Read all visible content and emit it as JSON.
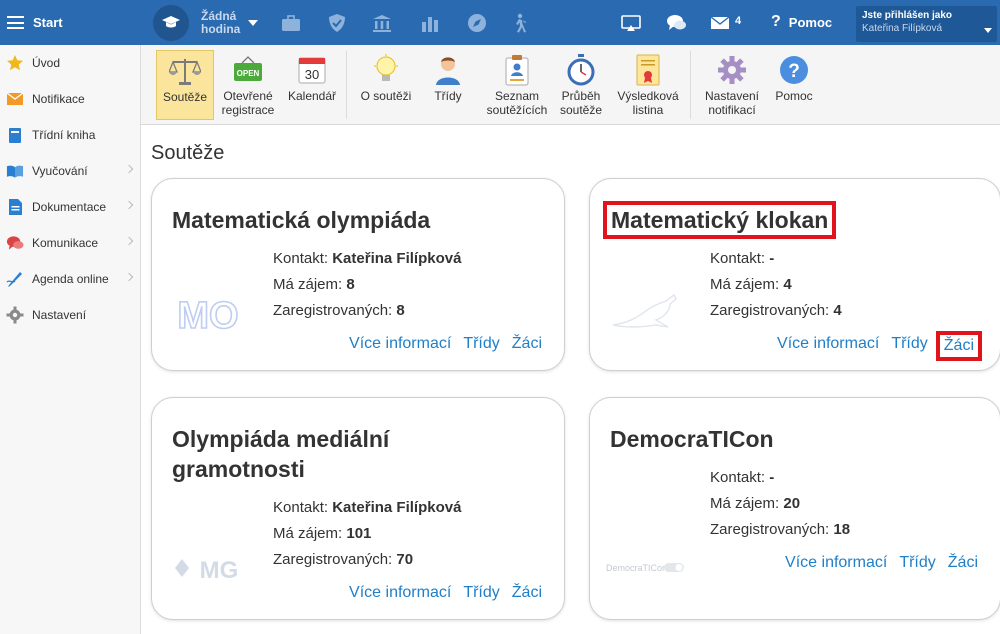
{
  "topbar": {
    "start_label": "Start",
    "lesson_line1": "Žádná",
    "lesson_line2": "hodina",
    "messages_count": "4",
    "help_label": "Pomoc",
    "user_title": "Jste přihlášen jako",
    "user_name": "Kateřina Filípková"
  },
  "sidebar": {
    "items": [
      {
        "label": "Úvod"
      },
      {
        "label": "Notifikace"
      },
      {
        "label": "Třídní kniha"
      },
      {
        "label": "Vyučování"
      },
      {
        "label": "Dokumentace"
      },
      {
        "label": "Komunikace"
      },
      {
        "label": "Agenda online"
      },
      {
        "label": "Nastavení"
      }
    ]
  },
  "ribbon": {
    "items": [
      {
        "l1": "Soutěže",
        "l2": ""
      },
      {
        "l1": "Otevřené",
        "l2": "registrace"
      },
      {
        "l1": "Kalendář",
        "l2": ""
      },
      {
        "l1": "O soutěži",
        "l2": ""
      },
      {
        "l1": "Třídy",
        "l2": ""
      },
      {
        "l1": "Seznam",
        "l2": "soutěžících"
      },
      {
        "l1": "Průběh",
        "l2": "soutěže"
      },
      {
        "l1": "Výsledková",
        "l2": "listina"
      },
      {
        "l1": "Nastavení",
        "l2": "notifikací"
      },
      {
        "l1": "Pomoc",
        "l2": ""
      }
    ],
    "open_badge": "OPEN",
    "calendar_day": "30"
  },
  "page_title": "Soutěže",
  "labels": {
    "contact": "Kontakt:",
    "interest": "Má zájem:",
    "registered": "Zaregistrovaných:",
    "more_info": "Více informací",
    "classes": "Třídy",
    "students": "Žáci"
  },
  "cards": [
    {
      "title_l1": "Matematická olympiáda",
      "title_l2": "",
      "contact": "Kateřina Filípková",
      "interest": "8",
      "registered": "8",
      "logo_text": "MO"
    },
    {
      "title_l1": "Matematický klokan",
      "title_l2": "",
      "contact": "-",
      "interest": "4",
      "registered": "4",
      "logo_text": ""
    },
    {
      "title_l1": "Olympiáda mediální",
      "title_l2": "gramotnosti",
      "contact": "Kateřina Filípková",
      "interest": "101",
      "registered": "70",
      "logo_text": "MG"
    },
    {
      "title_l1": "DemocraTICon",
      "title_l2": "",
      "contact": "-",
      "interest": "20",
      "registered": "18",
      "logo_text": "DemocraTICon"
    }
  ],
  "colors": {
    "topbar": "#2a6ab1",
    "link": "#1f7fc8",
    "highlight": "#e0141b",
    "active_tab": "#fbe59c"
  }
}
